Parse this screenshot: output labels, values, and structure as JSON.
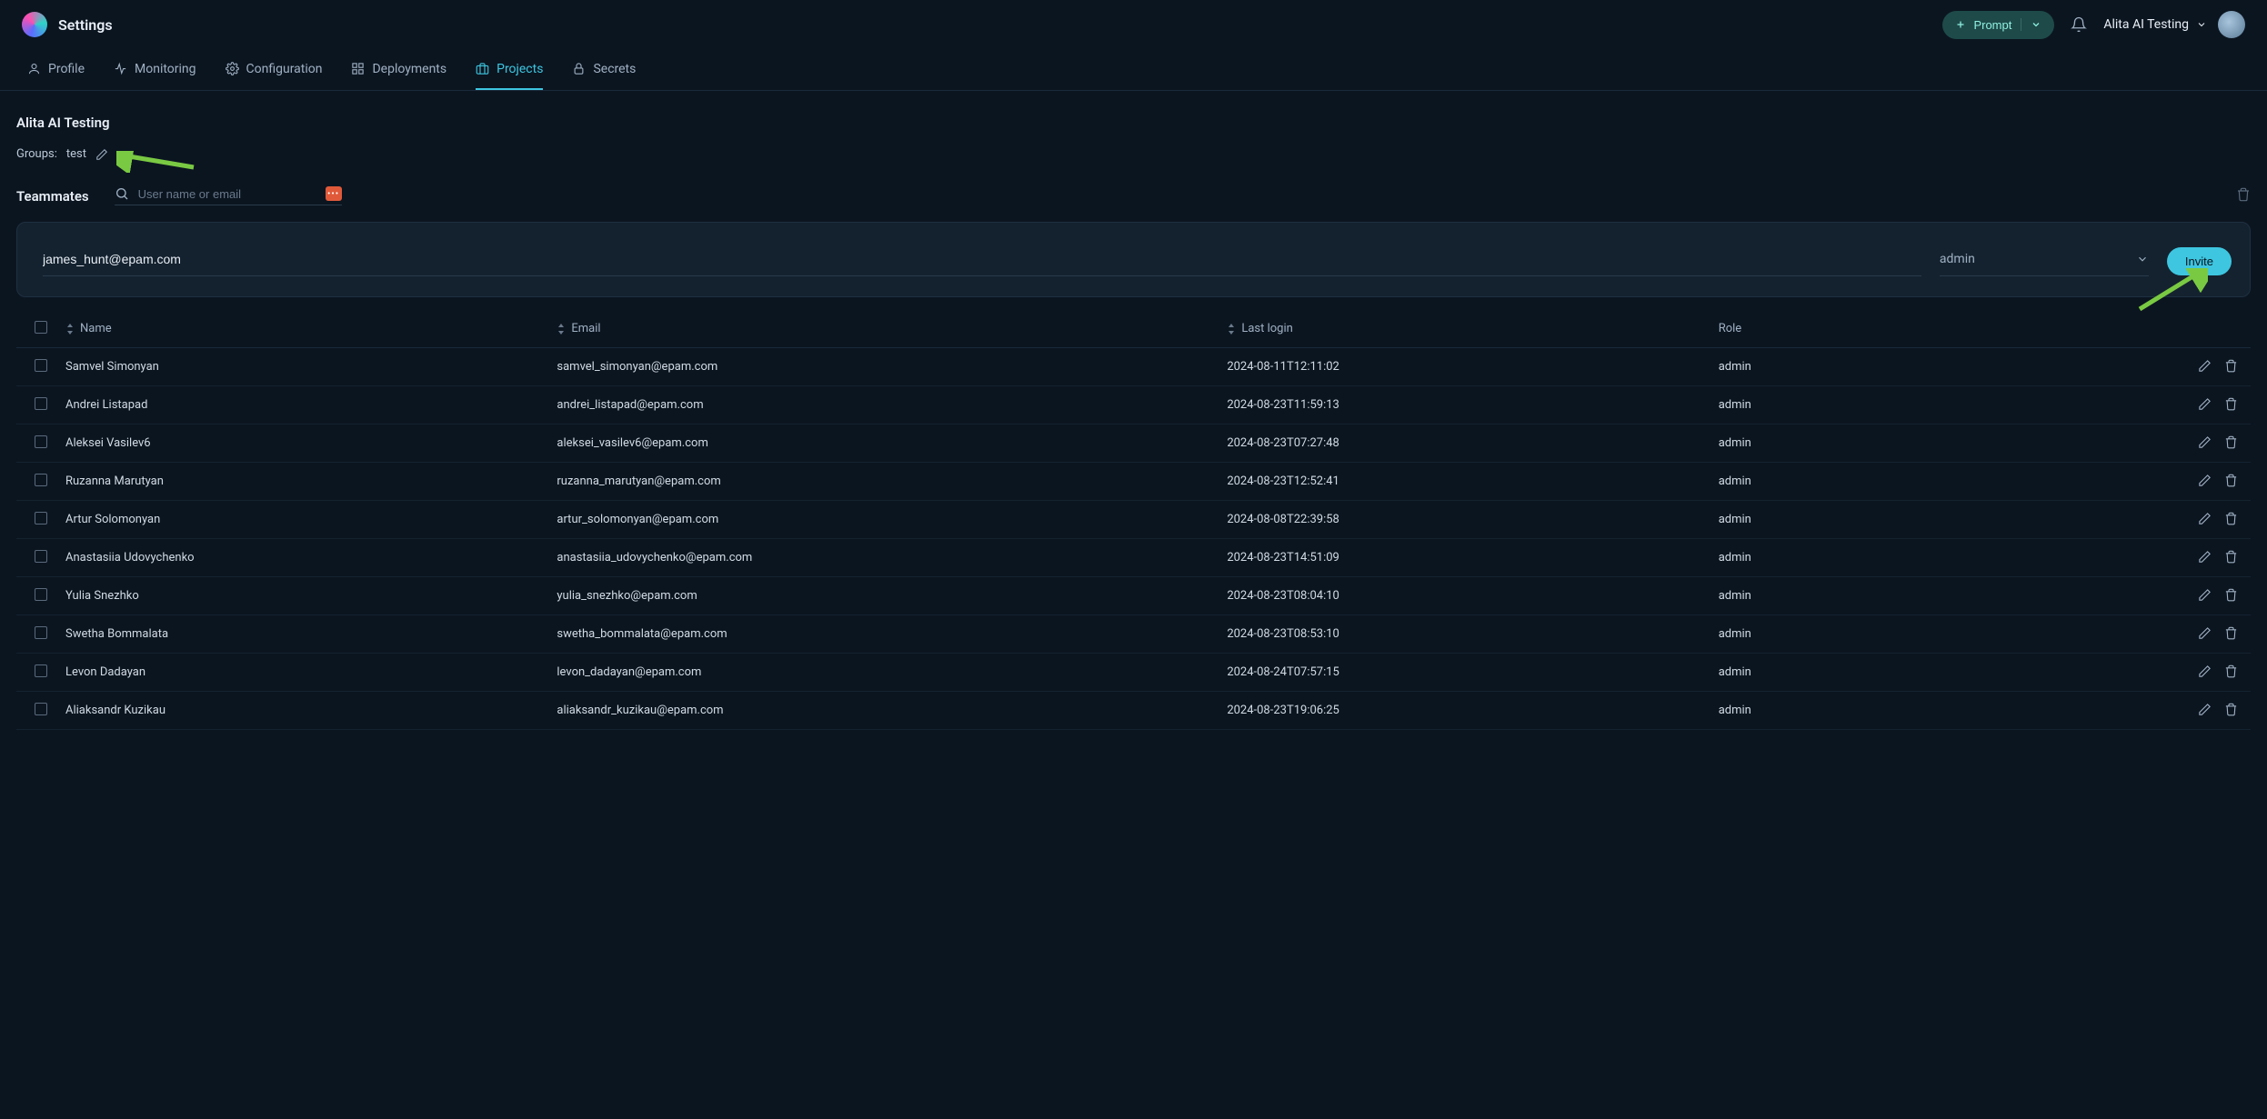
{
  "header": {
    "page_title": "Settings",
    "prompt_button": "Prompt",
    "workspace_name": "Alita AI Testing"
  },
  "tabs": [
    {
      "id": "profile",
      "label": "Profile"
    },
    {
      "id": "monitoring",
      "label": "Monitoring"
    },
    {
      "id": "configuration",
      "label": "Configuration"
    },
    {
      "id": "deployments",
      "label": "Deployments"
    },
    {
      "id": "projects",
      "label": "Projects"
    },
    {
      "id": "secrets",
      "label": "Secrets"
    }
  ],
  "active_tab": "projects",
  "project": {
    "title": "Alita AI Testing",
    "groups_label": "Groups:",
    "groups_value": "test"
  },
  "teammates": {
    "label": "Teammates",
    "search_placeholder": "User name or email",
    "status_chip": "•••"
  },
  "invite": {
    "email_value": "james_hunt@epam.com",
    "role_value": "admin",
    "button": "Invite"
  },
  "columns": {
    "name": "Name",
    "email": "Email",
    "last_login": "Last login",
    "role": "Role"
  },
  "rows": [
    {
      "name": "Samvel Simonyan",
      "email": "samvel_simonyan@epam.com",
      "last_login": "2024-08-11T12:11:02",
      "role": "admin"
    },
    {
      "name": "Andrei Listapad",
      "email": "andrei_listapad@epam.com",
      "last_login": "2024-08-23T11:59:13",
      "role": "admin"
    },
    {
      "name": "Aleksei Vasilev6",
      "email": "aleksei_vasilev6@epam.com",
      "last_login": "2024-08-23T07:27:48",
      "role": "admin"
    },
    {
      "name": "Ruzanna Marutyan",
      "email": "ruzanna_marutyan@epam.com",
      "last_login": "2024-08-23T12:52:41",
      "role": "admin"
    },
    {
      "name": "Artur Solomonyan",
      "email": "artur_solomonyan@epam.com",
      "last_login": "2024-08-08T22:39:58",
      "role": "admin"
    },
    {
      "name": "Anastasiia Udovychenko",
      "email": "anastasiia_udovychenko@epam.com",
      "last_login": "2024-08-23T14:51:09",
      "role": "admin"
    },
    {
      "name": "Yulia Snezhko",
      "email": "yulia_snezhko@epam.com",
      "last_login": "2024-08-23T08:04:10",
      "role": "admin"
    },
    {
      "name": "Swetha Bommalata",
      "email": "swetha_bommalata@epam.com",
      "last_login": "2024-08-23T08:53:10",
      "role": "admin"
    },
    {
      "name": "Levon Dadayan",
      "email": "levon_dadayan@epam.com",
      "last_login": "2024-08-24T07:57:15",
      "role": "admin"
    },
    {
      "name": "Aliaksandr Kuzikau",
      "email": "aliaksandr_kuzikau@epam.com",
      "last_login": "2024-08-23T19:06:25",
      "role": "admin"
    }
  ]
}
